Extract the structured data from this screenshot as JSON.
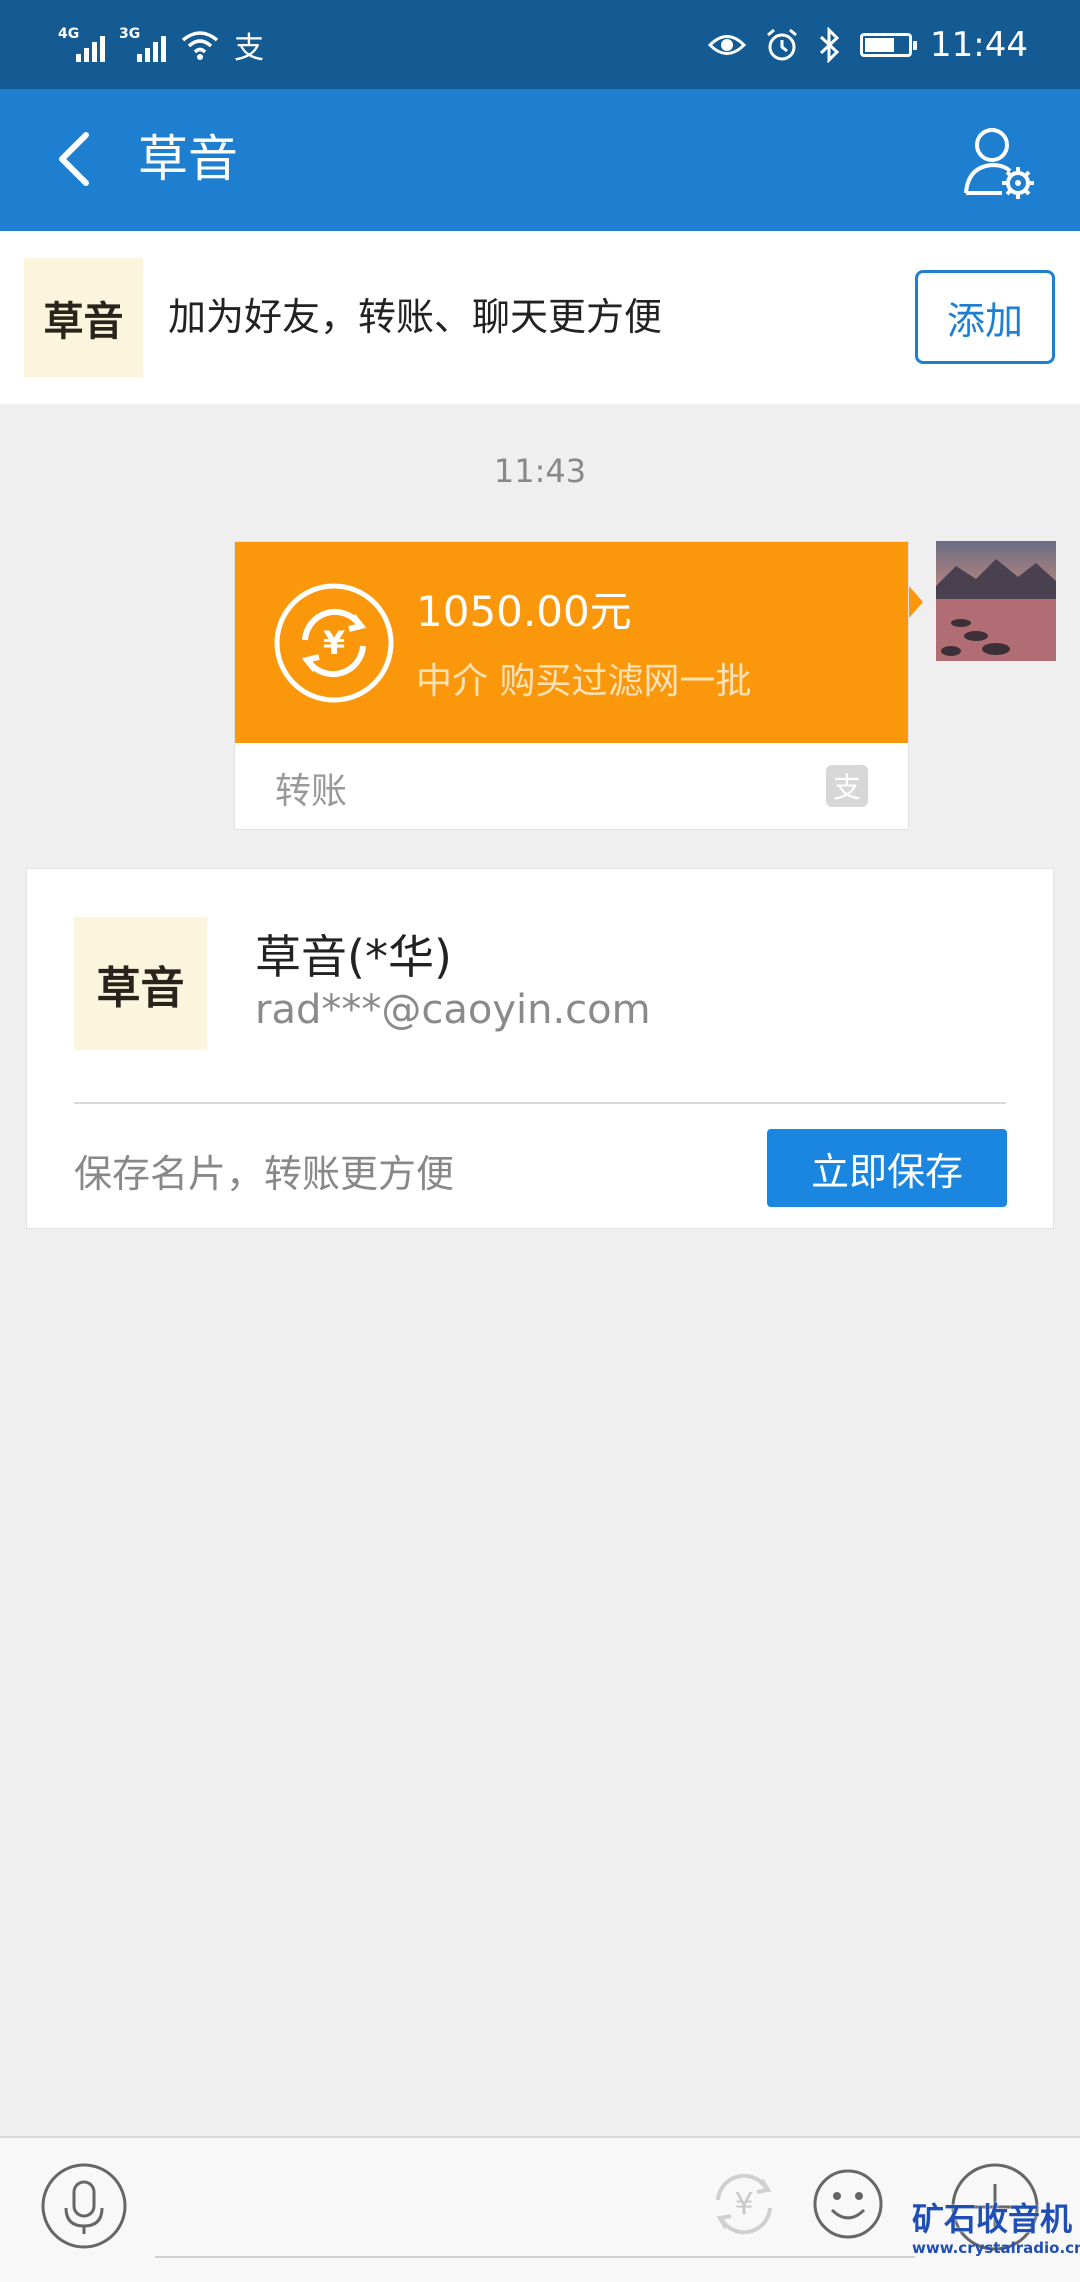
{
  "status_bar": {
    "net1": "4G",
    "net2": "3G",
    "pay_icon": "支",
    "time": "11:44",
    "battery_fraction": 0.7,
    "icons": [
      "signal-icon",
      "wifi-icon",
      "alipay-notification-icon",
      "eye-icon",
      "alarm-icon",
      "bluetooth-icon",
      "battery-icon"
    ]
  },
  "nav": {
    "title": "草音",
    "back_icon": "chevron-left-icon",
    "profile_icon": "user-settings-icon"
  },
  "banner": {
    "logo_text": "草音",
    "text": "加为好友，转账、聊天更方便",
    "add_label": "添加"
  },
  "chat": {
    "timestamp": "11:43",
    "transfer": {
      "amount": "1050.00元",
      "note": "中介 购买过滤网一批",
      "label": "转账",
      "icon": "yuan-transfer-icon",
      "brand_icon": "支"
    },
    "contact_card": {
      "logo_text": "草音",
      "name": "草音(*华)",
      "email": "rad***@caoyin.com",
      "hint": "保存名片，转账更方便",
      "save_label": "立即保存"
    }
  },
  "input_bar": {
    "icons": [
      "microphone-icon",
      "yuan-icon",
      "emoji-icon",
      "plus-icon"
    ]
  },
  "watermark": {
    "main": "矿石收音机",
    "url": "www.crystalradio.cn"
  },
  "colors": {
    "status_bar": "#135b92",
    "nav_bar": "#1e7fd0",
    "transfer_orange": "#fb970a",
    "save_blue": "#1a86e0"
  }
}
